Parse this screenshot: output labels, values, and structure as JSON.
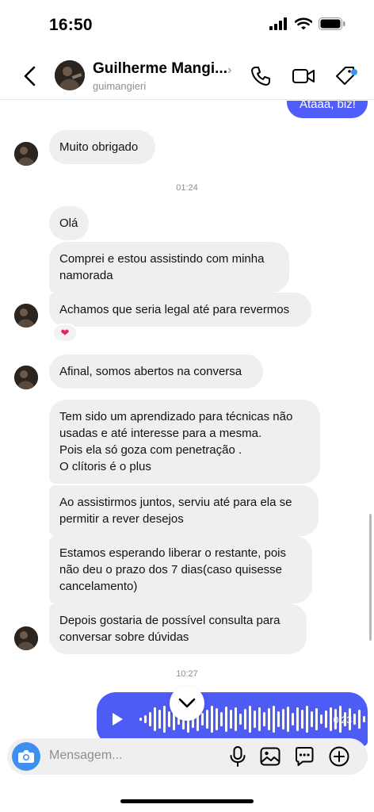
{
  "status": {
    "time": "16:50"
  },
  "header": {
    "name": "Guilherme Mangi...",
    "username": "guimangieri"
  },
  "messages": {
    "partial_outgoing": "Ataaa, biz!",
    "m1": "Muito obrigado",
    "ts1": "01:24",
    "m2": "Olá",
    "m3_l1": "Comprei e estou assistindo com minha",
    "m3_l2": "namorada",
    "m4": "Achamos que seria legal até para revermos",
    "reaction": "❤",
    "m5": "Afinal, somos abertos na conversa",
    "m6_l1": "Tem sido um aprendizado para técnicas não",
    "m6_l2": "usadas e até interesse para a mesma.",
    "m6_l3": "Pois ela só goza com penetração .",
    "m6_l4": "O clítoris é o plus",
    "m7_l1": "Ao assistirmos juntos, serviu até para ela se",
    "m7_l2": "permitir a rever desejos",
    "m8_l1": "Estamos esperando liberar o restante, pois",
    "m8_l2": "não deu o prazo dos 7 dias(caso quisesse",
    "m8_l3": "cancelamento)",
    "m9_l1": "Depois gostaria de possível consulta para",
    "m9_l2": "conversar sobre dúvidas",
    "ts2": "10:27"
  },
  "voice": {
    "duration": "0:23"
  },
  "composer": {
    "placeholder": "Mensagem..."
  },
  "colors": {
    "outgoing": "#4f5dfb",
    "incoming": "#efefef",
    "accent": "#3f8ff0"
  },
  "icons": [
    "back-chevron-icon",
    "phone-icon",
    "video-call-icon",
    "tag-icon",
    "camera-icon",
    "microphone-icon",
    "gallery-icon",
    "sticker-icon",
    "plus-circle-icon",
    "play-icon",
    "chevron-down-icon"
  ]
}
